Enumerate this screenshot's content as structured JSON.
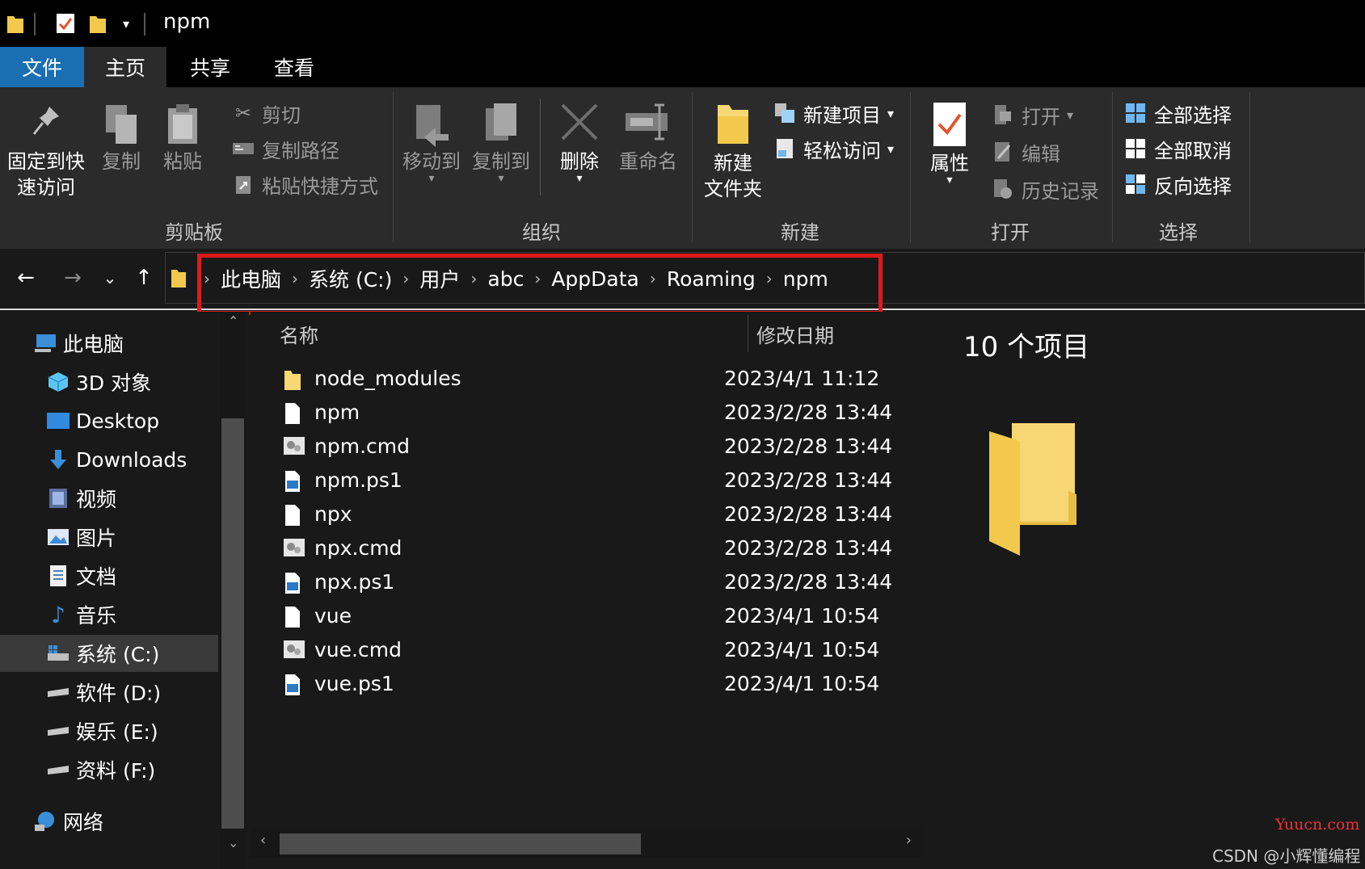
{
  "window": {
    "title": "npm"
  },
  "tabs": [
    {
      "label": "文件"
    },
    {
      "label": "主页"
    },
    {
      "label": "共享"
    },
    {
      "label": "查看"
    }
  ],
  "ribbon": {
    "clipboard": {
      "pin_line1": "固定到快",
      "pin_line2": "速访问",
      "copy": "复制",
      "paste": "粘贴",
      "cut": "剪切",
      "copy_path": "复制路径",
      "paste_shortcut": "粘贴快捷方式",
      "group": "剪贴板"
    },
    "organize": {
      "move_to": "移动到",
      "copy_to": "复制到",
      "delete": "删除",
      "rename": "重命名",
      "group": "组织"
    },
    "new": {
      "new_folder_line1": "新建",
      "new_folder_line2": "文件夹",
      "new_item": "新建项目",
      "easy_access": "轻松访问",
      "group": "新建"
    },
    "open": {
      "properties": "属性",
      "open": "打开",
      "edit": "编辑",
      "history": "历史记录",
      "group": "打开"
    },
    "select": {
      "select_all": "全部选择",
      "select_none": "全部取消",
      "invert": "反向选择",
      "group": "选择"
    }
  },
  "breadcrumb": [
    "此电脑",
    "系统 (C:)",
    "用户",
    "abc",
    "AppData",
    "Roaming",
    "npm"
  ],
  "sidebar": {
    "items": [
      {
        "label": "此电脑",
        "icon": "computer-icon"
      },
      {
        "label": "3D 对象",
        "icon": "cube-icon"
      },
      {
        "label": "Desktop",
        "icon": "desktop-icon"
      },
      {
        "label": "Downloads",
        "icon": "download-icon"
      },
      {
        "label": "视频",
        "icon": "video-icon"
      },
      {
        "label": "图片",
        "icon": "pictures-icon"
      },
      {
        "label": "文档",
        "icon": "document-icon"
      },
      {
        "label": "音乐",
        "icon": "music-icon"
      },
      {
        "label": "系统 (C:)",
        "icon": "system-drive-icon"
      },
      {
        "label": "软件 (D:)",
        "icon": "drive-icon"
      },
      {
        "label": "娱乐 (E:)",
        "icon": "drive-icon"
      },
      {
        "label": "资料 (F:)",
        "icon": "drive-icon"
      },
      {
        "label": "网络",
        "icon": "network-icon"
      }
    ]
  },
  "filelist": {
    "col_name": "名称",
    "col_date": "修改日期",
    "files": [
      {
        "name": "node_modules",
        "date": "2023/4/1 11:12",
        "type": "folder"
      },
      {
        "name": "npm",
        "date": "2023/2/28 13:44",
        "type": "file"
      },
      {
        "name": "npm.cmd",
        "date": "2023/2/28 13:44",
        "type": "cmd"
      },
      {
        "name": "npm.ps1",
        "date": "2023/2/28 13:44",
        "type": "ps1"
      },
      {
        "name": "npx",
        "date": "2023/2/28 13:44",
        "type": "file"
      },
      {
        "name": "npx.cmd",
        "date": "2023/2/28 13:44",
        "type": "cmd"
      },
      {
        "name": "npx.ps1",
        "date": "2023/2/28 13:44",
        "type": "ps1"
      },
      {
        "name": "vue",
        "date": "2023/4/1 10:54",
        "type": "file"
      },
      {
        "name": "vue.cmd",
        "date": "2023/4/1 10:54",
        "type": "cmd"
      },
      {
        "name": "vue.ps1",
        "date": "2023/4/1 10:54",
        "type": "ps1"
      }
    ]
  },
  "preview": {
    "item_count": "10 个项目"
  },
  "watermark": {
    "site": "Yuucn.com",
    "author": "CSDN @小辉懂编程"
  },
  "colors": {
    "highlight": "#e01a1a",
    "file_tab": "#1a6fb3",
    "folder": "#f7d774"
  }
}
